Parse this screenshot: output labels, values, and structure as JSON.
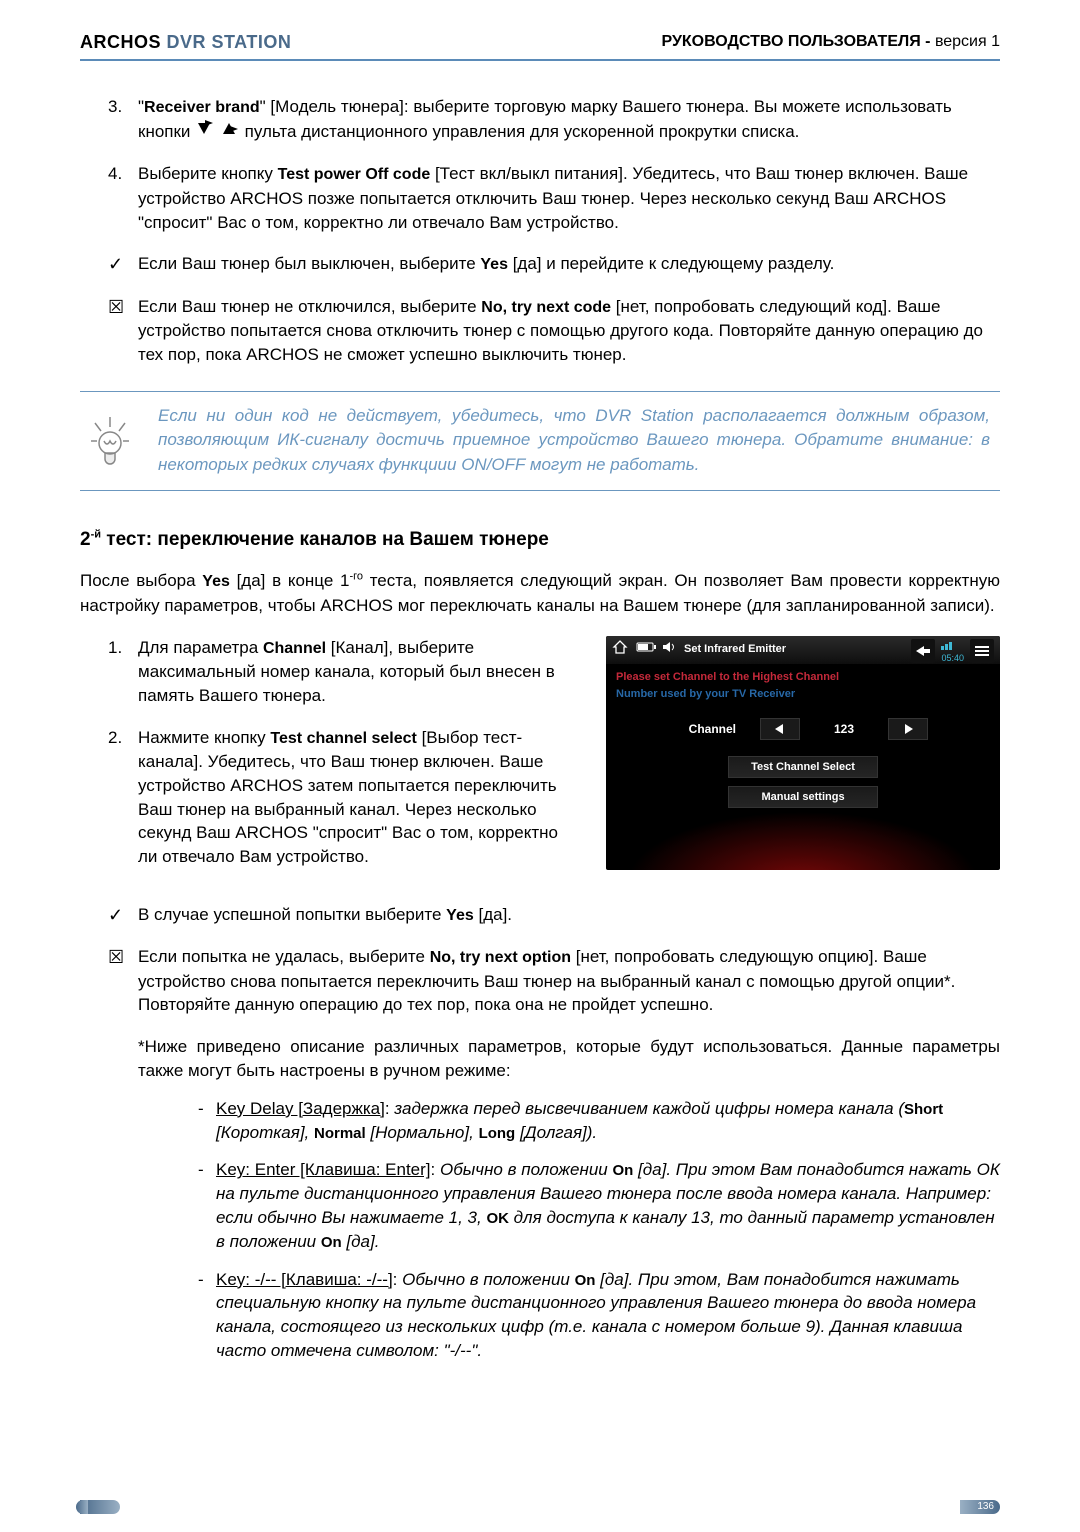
{
  "header": {
    "brand_archos": "ARCHOS",
    "brand_suffix": " DVR STATION",
    "doc_label": "РУКОВОДСТВО ПОЛЬЗОВАТЕЛЯ - ",
    "version": "версия 1"
  },
  "list1": {
    "item3": {
      "num": "3.",
      "pre": "\"",
      "bold": "Receiver brand",
      "post": "\" [Модель тюнера]: выберите торговую марку Вашего тюнера. Вы можете использовать кнопки ",
      "post2": " пульта дистанционного управления для ускоренной прокрутки списка."
    },
    "item4": {
      "num": "4.",
      "pre": "Выберите кнопку ",
      "bold": "Test power Off code",
      "post": " [Тест вкл/выкл питания]. Убедитесь, что Ваш тюнер включен. Ваше устройство ARCHOS позже попытается отключить Ваш тюнер. Через несколько секунд Ваш ARCHOS \"спросит\" Вас о том, корректно ли отвечало Вам устройство."
    }
  },
  "checks1": {
    "yes": {
      "mark": "✓",
      "pre": "Если Ваш тюнер был выключен, выберите ",
      "bold": "Yes",
      "post": " [да] и перейдите к следующему разделу."
    },
    "no": {
      "mark": "☒",
      "pre": "Если Ваш тюнер не отключился, выберите ",
      "bold": "No, try next code",
      "post": " [нет, попробовать следующий код]. Ваше устройство попытается снова отключить тюнер с помощью другого кода. Повторяйте данную операцию до тех пор, пока ARCHOS не сможет успешно выключить тюнер."
    }
  },
  "tip": "Если ни один код не действует, убедитесь, что DVR Station располагается должным образом, позволяющим ИК-сигналу достичь приемное устройство Вашего тюнера. Обратите внимание: в некоторых редких случаях функциии ON/OFF могут не работать.",
  "sect2": {
    "title_prefix": "2",
    "title_sup": "-й",
    "title_rest": " тест: переключение каналов на Вашем тюнере",
    "intro_pre": "После выбора ",
    "intro_yes": "Yes",
    "intro_mid": " [да] в конце 1",
    "intro_sup": "-го",
    "intro_post": " теста, появляется следующий экран. Он позволяет Вам провести корректную настройку параметров, чтобы ARCHOS мог переключать каналы на Вашем тюнере (для запланированной записи)."
  },
  "list2": {
    "item1": {
      "num": "1.",
      "pre": "Для параметра ",
      "bold": "Channel",
      "post": " [Канал], выберите максимальный номер канала, который был внесен в память Вашего тюнера."
    },
    "item2": {
      "num": "2.",
      "pre": "Нажмите кнопку ",
      "bold": "Test channel select",
      "post": " [Выбор тест-канала]. Убедитесь, что Ваш тюнер включен. Ваше устройство ARCHOS затем попытается переключить Ваш тюнер на выбранный канал. Через несколько секунд Ваш ARCHOS \"спросит\" Вас о том, корректно ли отвечало Вам устройство."
    }
  },
  "device": {
    "title": "Set Infrared Emitter",
    "time": "05:40",
    "instr1": "Please set Channel to the Highest Channel",
    "instr2": "Number used by your TV Receiver",
    "channel_label": "Channel",
    "channel_value": "123",
    "btn_test": "Test Channel Select",
    "btn_manual": "Manual settings"
  },
  "checks2": {
    "yes": {
      "mark": "✓",
      "pre": "В случае успешной попытки выберите ",
      "bold": "Yes",
      "post": " [да]."
    },
    "no": {
      "mark": "☒",
      "pre": "Если попытка не удалась, выберите ",
      "bold": "No, try next option",
      "post": " [нет, попробовать следующую опцию]. Ваше устройство снова попытается переключить Ваш тюнер на выбранный канал с помощью другой опции*. Повторяйте данную операцию до тех пор, пока она не пройдет успешно."
    }
  },
  "asterisk": "*Ниже приведено описание различных параметров, которые будут использоваться. Данные параметры также могут быть настроены в ручном режиме:",
  "opts": {
    "keydelay": {
      "u": "Key Delay [Задержка]",
      "colon": ": ",
      "body_pre": "задержка перед высвечиванием каждой цифры номера канала (",
      "b1": "Short",
      "t1": " [Короткая], ",
      "b2": "Normal",
      "t2": " [Нормально], ",
      "b3": "Long",
      "t3": " [Долгая])."
    },
    "keyenter": {
      "u": "Key: Enter [Клавиша: Enter]",
      "colon": ": ",
      "body_pre": "Обычно в положении ",
      "b_on": "On",
      "body_mid1": " [да]. При этом Вам понадобится нажать ОК на пульте дистанционного управления Вашего тюнера после ввода номера канала. Например: если обычно Вы нажимаете 1, 3, ",
      "b_ok": "OK",
      "body_mid2": " для доступа к каналу 13, то данный параметр установлен в положении ",
      "b_on2": "On",
      "body_post": " [да]."
    },
    "keydash": {
      "u": "Key: -/-- [Клавиша: -/--]",
      "colon": ": ",
      "body_pre": "Обычно в положении ",
      "b_on": "On",
      "body_post": " [да]. При этом, Вам понадобится нажимать специальную кнопку на пульте дистанционного управления Вашего тюнера до ввода номера канала, состоящего из нескольких цифр (т.е. канала с номером больше 9). Данная клавиша часто отмечена символом: \"-/--\"."
    }
  },
  "page_num": "136"
}
